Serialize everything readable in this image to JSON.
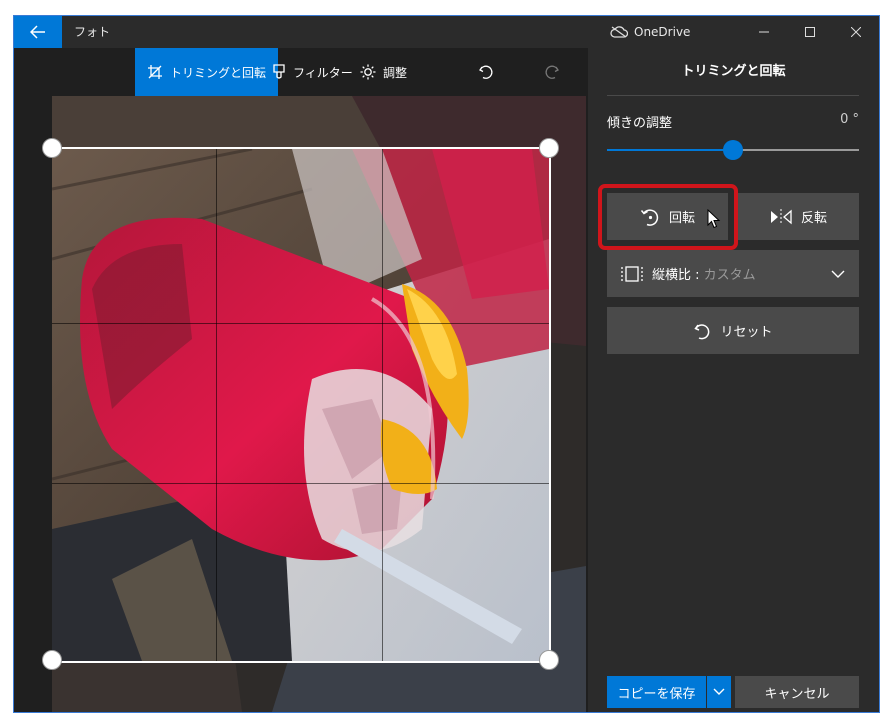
{
  "window": {
    "app_title": "フォト",
    "onedrive_label": "OneDrive"
  },
  "toolbar": {
    "crop_rotate_label": "トリミングと回転",
    "filter_label": "フィルター",
    "adjust_label": "調整"
  },
  "panel": {
    "title": "トリミングと回転",
    "straighten_label": "傾きの調整",
    "straighten_value": "0 °",
    "straighten_fraction": 0.5,
    "rotate_label": "回転",
    "flip_label": "反転",
    "aspect_label": "縦横比 : ",
    "aspect_value": "カスタム",
    "reset_label": "リセット",
    "save_copy_label": "コピーを保存",
    "cancel_label": "キャンセル"
  },
  "colors": {
    "accent": "#0078d7",
    "highlight": "#d0151b"
  }
}
